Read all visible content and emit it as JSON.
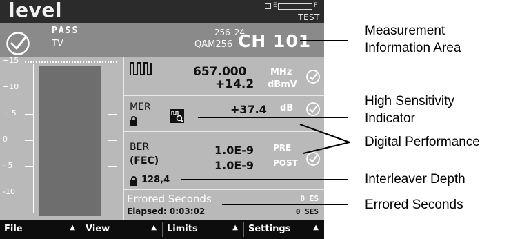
{
  "header": {
    "title": "level",
    "battery_empty": "E",
    "battery_full": "F",
    "mode": "TEST"
  },
  "info": {
    "status": "PASS",
    "type": "TV",
    "channel_plan": "256_24",
    "modulation": "QAM256",
    "channel": "CH 101"
  },
  "gauge": {
    "ticks": [
      "+15",
      "+10",
      "+ 5",
      "0",
      "- 5",
      "-10"
    ],
    "range": [
      -15,
      15
    ],
    "level_dbmv": 14.2
  },
  "measurements": {
    "frequency": {
      "value": "657.000",
      "unit": "MHz"
    },
    "level": {
      "value": "+14.2",
      "unit": "dBmV"
    },
    "mer": {
      "label": "MER",
      "value": "+37.4",
      "unit": "dB"
    },
    "ber": {
      "label": "BER",
      "fec_label": "(FEC)",
      "pre_value": "1.0E-9",
      "pre_unit": "PRE",
      "post_value": "1.0E-9",
      "post_unit": "POST"
    },
    "interleaver_depth": "128,4",
    "errored_seconds": {
      "label": "Errored Seconds",
      "elapsed": "Elapsed: 0:03:02",
      "es": "0 ES",
      "ses": "0 SES"
    }
  },
  "softkeys": [
    {
      "label": "File",
      "arrow": "▲"
    },
    {
      "label": "View",
      "arrow": "▲"
    },
    {
      "label": "Limits",
      "arrow": "▲"
    },
    {
      "label": "Settings",
      "arrow": "▲"
    }
  ],
  "callouts": [
    "Measurement",
    "Information Area",
    "High Sensitivity",
    "Indicator",
    "Digital Performance",
    "Interleaver Depth",
    "Errored Seconds"
  ],
  "colors": {
    "screen_bg": "#b9b9b9",
    "title_bar": "#2b2b2b",
    "info_bar": "#8a8a8a",
    "level_bar": "#6e6e6e",
    "softkey_bar": "#0d0d0d"
  },
  "icons": {
    "status": "check-circle-icon",
    "signal": "square-wave-icon",
    "lock": "padlock-icon",
    "high_sensitivity": "magnifier-wave-icon"
  }
}
